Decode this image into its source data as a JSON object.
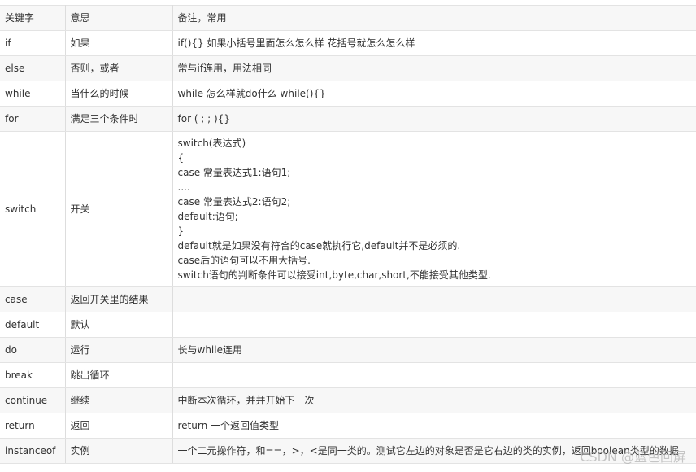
{
  "table": {
    "headers": [
      "关键字",
      "意思",
      "备注，常用"
    ],
    "rows": [
      {
        "keyword": "if",
        "meaning": "如果",
        "notes": [
          "if(){} 如果小括号里面怎么怎么样 花括号就怎么怎么样"
        ]
      },
      {
        "keyword": "else",
        "meaning": "否则，或者",
        "notes": [
          "常与if连用，用法相同"
        ]
      },
      {
        "keyword": "while",
        "meaning": "当什么的时候",
        "notes": [
          "while 怎么样就do什么    while(){}"
        ]
      },
      {
        "keyword": "for",
        "meaning": "满足三个条件时",
        "notes": [
          "for ( ; ; ){}"
        ]
      },
      {
        "keyword": "switch",
        "meaning": "开关",
        "notes": [
          "switch(表达式)",
          "{",
          "case 常量表达式1:语句1;",
          "....",
          "case 常量表达式2:语句2;",
          "default:语句;",
          "}",
          "default就是如果没有符合的case就执行它,default并不是必须的.",
          "case后的语句可以不用大括号.",
          "switch语句的判断条件可以接受int,byte,char,short,不能接受其他类型."
        ]
      },
      {
        "keyword": "case",
        "meaning": "返回开关里的结果",
        "notes": []
      },
      {
        "keyword": "default",
        "meaning": "默认",
        "notes": []
      },
      {
        "keyword": "do",
        "meaning": "运行",
        "notes": [
          "长与while连用"
        ]
      },
      {
        "keyword": "break",
        "meaning": "跳出循环",
        "notes": []
      },
      {
        "keyword": "continue",
        "meaning": "继续",
        "notes": [
          "中断本次循环，并并开始下一次"
        ]
      },
      {
        "keyword": "return",
        "meaning": "返回",
        "notes": [
          "return 一个返回值类型"
        ]
      },
      {
        "keyword": "instanceof",
        "meaning": "实例",
        "notes": [
          "一个二元操作符，和==，>，<是同一类的。测试它左边的对象是否是它右边的类的实例，返回boolean类型的数据"
        ]
      }
    ]
  },
  "watermark": "CSDN @蓝色回屏"
}
